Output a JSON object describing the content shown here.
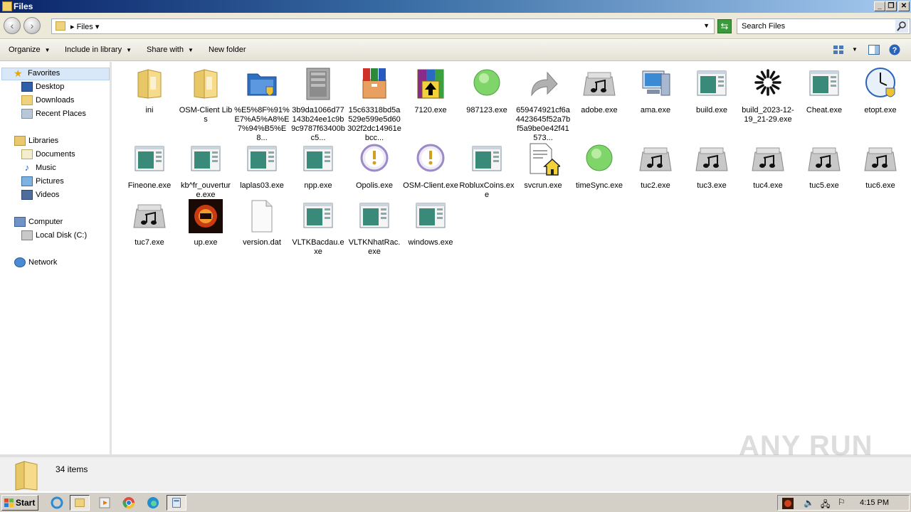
{
  "window": {
    "title": "Files"
  },
  "address": {
    "crumb": "Files",
    "search_placeholder": "Search Files"
  },
  "commands": {
    "organize": "Organize",
    "include": "Include in library",
    "share": "Share with",
    "new_folder": "New folder"
  },
  "nav": {
    "favorites": "Favorites",
    "desktop": "Desktop",
    "downloads": "Downloads",
    "recent": "Recent Places",
    "libraries": "Libraries",
    "documents": "Documents",
    "music": "Music",
    "pictures": "Pictures",
    "videos": "Videos",
    "computer": "Computer",
    "local_disk": "Local Disk (C:)",
    "network": "Network"
  },
  "files": [
    {
      "name": "ini",
      "icon": "folder-icon"
    },
    {
      "name": "OSM-Client Libs",
      "icon": "folder-icon"
    },
    {
      "name": "%E5%8F%91%E7%A5%A8%E7%94%B5%E8...",
      "icon": "shield-folder-icon"
    },
    {
      "name": "3b9da1066d77143b24ee1c9b9c9787f63400bc5...",
      "icon": "grey-archive-icon"
    },
    {
      "name": "15c63318bd5a529e599e5d60302f2dc14961ebcc...",
      "icon": "package-icon"
    },
    {
      "name": "7120.exe",
      "icon": "winrar-icon"
    },
    {
      "name": "987123.exe",
      "icon": "green-circle-icon"
    },
    {
      "name": "659474921cf6a4423645f52a7bf5a9be0e42f41573...",
      "icon": "shortcut-arrow-icon"
    },
    {
      "name": "adobe.exe",
      "icon": "audio-file-icon"
    },
    {
      "name": "ama.exe",
      "icon": "computer-icon"
    },
    {
      "name": "build.exe",
      "icon": "app-window-icon"
    },
    {
      "name": "build_2023-12-19_21-29.exe",
      "icon": "spinner-icon"
    },
    {
      "name": "Cheat.exe",
      "icon": "app-window-icon"
    },
    {
      "name": "etopt.exe",
      "icon": "clock-icon"
    },
    {
      "name": "Fineone.exe",
      "icon": "app-window-icon"
    },
    {
      "name": "kb^fr_ouverture.exe",
      "icon": "app-window-icon"
    },
    {
      "name": "laplas03.exe",
      "icon": "app-window-icon"
    },
    {
      "name": "npp.exe",
      "icon": "app-window-icon"
    },
    {
      "name": "Opolis.exe",
      "icon": "warning-circle-icon"
    },
    {
      "name": "OSM-Client.exe",
      "icon": "warning-circle-icon"
    },
    {
      "name": "RobluxCoins.exe",
      "icon": "app-window-icon"
    },
    {
      "name": "svcrun.exe",
      "icon": "document-house-icon"
    },
    {
      "name": "timeSync.exe",
      "icon": "green-circle-icon"
    },
    {
      "name": "tuc2.exe",
      "icon": "audio-file-icon"
    },
    {
      "name": "tuc3.exe",
      "icon": "audio-file-icon"
    },
    {
      "name": "tuc4.exe",
      "icon": "audio-file-icon"
    },
    {
      "name": "tuc5.exe",
      "icon": "audio-file-icon"
    },
    {
      "name": "tuc6.exe",
      "icon": "audio-file-icon"
    },
    {
      "name": "tuc7.exe",
      "icon": "audio-file-icon"
    },
    {
      "name": "up.exe",
      "icon": "game-logo-icon"
    },
    {
      "name": "version.dat",
      "icon": "blank-file-icon"
    },
    {
      "name": "VLTKBacdau.exe",
      "icon": "app-window-icon"
    },
    {
      "name": "VLTKNhatRac.exe",
      "icon": "app-window-icon"
    },
    {
      "name": "windows.exe",
      "icon": "app-window-icon"
    }
  ],
  "status": {
    "count": "34 items"
  },
  "taskbar": {
    "start": "Start",
    "clock": "4:15 PM"
  },
  "watermark": "ANY RUN"
}
